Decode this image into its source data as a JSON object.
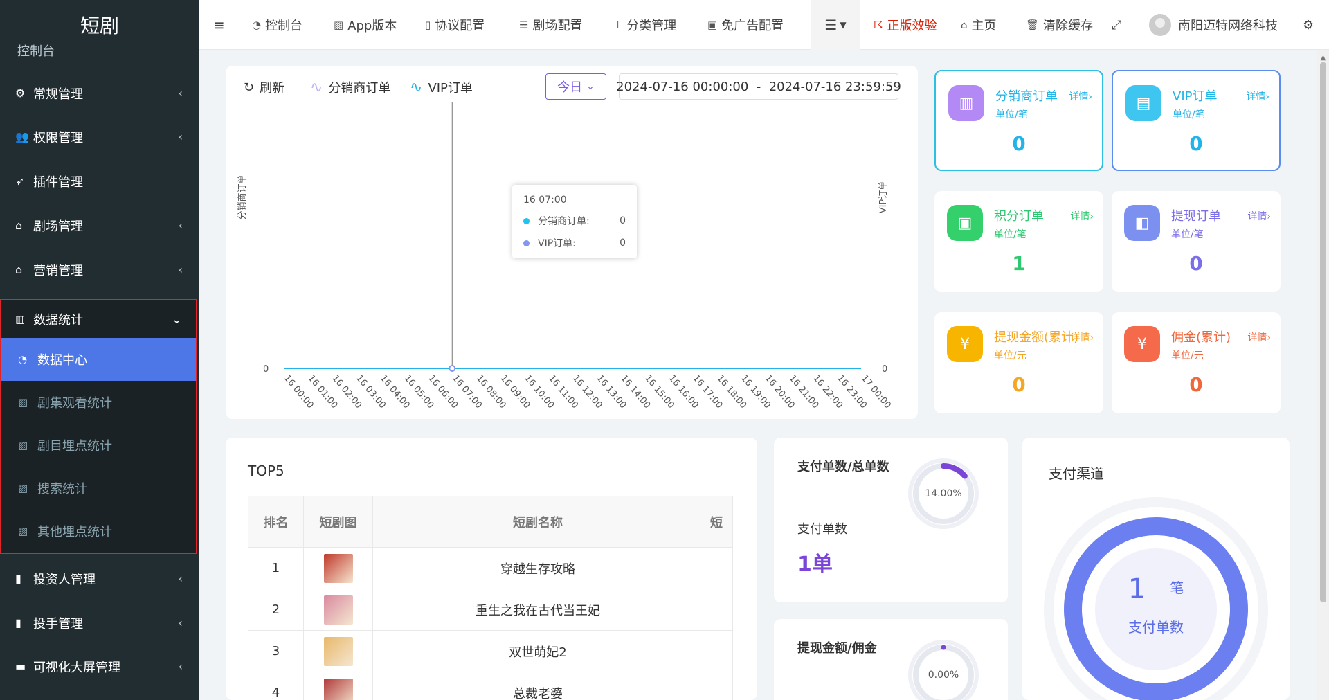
{
  "brand": "短剧",
  "sidebar": {
    "partial_item": "控制台",
    "items": [
      {
        "label": "常规管理",
        "icon": "gears-icon"
      },
      {
        "label": "权限管理",
        "icon": "users-icon"
      },
      {
        "label": "插件管理",
        "icon": "rocket-icon"
      },
      {
        "label": "剧场管理",
        "icon": "home-icon"
      },
      {
        "label": "营销管理",
        "icon": "home-icon"
      }
    ],
    "stats_group": {
      "label": "数据统计",
      "icon": "bar-chart-icon",
      "children": [
        {
          "label": "数据中心",
          "icon": "dashboard-icon",
          "active": true
        },
        {
          "label": "剧集观看统计",
          "icon": "image-icon"
        },
        {
          "label": "剧目埋点统计",
          "icon": "image-icon"
        },
        {
          "label": "搜索统计",
          "icon": "image-icon"
        },
        {
          "label": "其他埋点统计",
          "icon": "image-icon"
        }
      ]
    },
    "bottom_items": [
      {
        "label": "投资人管理",
        "icon": "id-card-icon"
      },
      {
        "label": "投手管理",
        "icon": "id-card-icon"
      },
      {
        "label": "可视化大屏管理",
        "icon": "credit-card-icon"
      }
    ]
  },
  "topbar": {
    "nav": [
      {
        "label": "控制台",
        "icon": "dashboard-icon"
      },
      {
        "label": "App版本",
        "icon": "image-icon"
      },
      {
        "label": "协议配置",
        "icon": "file-icon"
      },
      {
        "label": "剧场配置",
        "icon": "sliders-icon"
      },
      {
        "label": "分类管理",
        "icon": "sitemap-icon"
      },
      {
        "label": "免广告配置",
        "icon": "vimeo-icon"
      }
    ],
    "right": {
      "rss_label": "正版效验",
      "home_label": "主页",
      "clear_label": "清除缓存",
      "user": "南阳迈特网络科技"
    }
  },
  "chart": {
    "refresh_label": "刷新",
    "today_label": "今日",
    "date_range": "2024-07-16 00:00:00  -  2024-07-16 23:59:59",
    "tooltip": {
      "time": "16 07:00",
      "rows": [
        {
          "label": "分销商订单:",
          "value": "0",
          "color": "#22c3f1"
        },
        {
          "label": "VIP订单:",
          "value": "0",
          "color": "#8396f0"
        }
      ]
    }
  },
  "chart_data": {
    "type": "line",
    "x": [
      "16 00:00",
      "16 01:00",
      "16 02:00",
      "16 03:00",
      "16 04:00",
      "16 05:00",
      "16 06:00",
      "16 07:00",
      "16 08:00",
      "16 09:00",
      "16 10:00",
      "16 11:00",
      "16 12:00",
      "16 13:00",
      "16 14:00",
      "16 15:00",
      "16 16:00",
      "16 17:00",
      "16 18:00",
      "16 19:00",
      "16 20:00",
      "16 21:00",
      "16 22:00",
      "16 23:00",
      "17 00:00"
    ],
    "series": [
      {
        "name": "分销商订单",
        "color": "#c4b5f5",
        "values": [
          0,
          0,
          0,
          0,
          0,
          0,
          0,
          0,
          0,
          0,
          0,
          0,
          0,
          0,
          0,
          0,
          0,
          0,
          0,
          0,
          0,
          0,
          0,
          0,
          0
        ]
      },
      {
        "name": "VIP订单",
        "color": "#22b4e8",
        "values": [
          0,
          0,
          0,
          0,
          0,
          0,
          0,
          0,
          0,
          0,
          0,
          0,
          0,
          0,
          0,
          0,
          0,
          0,
          0,
          0,
          0,
          0,
          0,
          0,
          0
        ]
      }
    ],
    "ylabel_left": "分销商订单",
    "ylabel_right": "VIP订单",
    "y_ticks_left": [
      "0"
    ],
    "y_ticks_right": [
      "0"
    ],
    "highlight_x": "16 07:00"
  },
  "stat_cards": [
    {
      "title": "分销商订单",
      "unit": "单位/笔",
      "value": "0",
      "detail": "详情›",
      "color": "#22b4e8",
      "icon_bg": "#b38af5",
      "icon": "bar-chart-icon"
    },
    {
      "title": "VIP订单",
      "unit": "单位/笔",
      "value": "0",
      "detail": "详情›",
      "color": "#22b4e8",
      "icon_bg": "#3fc6f0",
      "icon": "document-icon"
    },
    {
      "title": "积分订单",
      "unit": "单位/笔",
      "value": "1",
      "detail": "详情›",
      "color": "#2ec870",
      "icon_bg": "#34d06c",
      "icon": "wallet-icon"
    },
    {
      "title": "提现订单",
      "unit": "单位/笔",
      "value": "0",
      "detail": "详情›",
      "color": "#7b6ee8",
      "icon_bg": "#7c90f0",
      "icon": "purse-icon"
    },
    {
      "title": "提现金额(累计)",
      "unit": "单位/元",
      "value": "0",
      "detail": "详情›",
      "color": "#f5a623",
      "icon_bg": "#f7b500",
      "icon": "shield-yen-icon"
    },
    {
      "title": "佣金(累计)",
      "unit": "单位/元",
      "value": "0",
      "detail": "详情›",
      "color": "#f0673c",
      "icon_bg": "#f46a4a",
      "icon": "yen-circle-icon"
    }
  ],
  "top5": {
    "title": "TOP5",
    "headers": [
      "排名",
      "短剧图",
      "短剧名称",
      "短"
    ],
    "rows": [
      {
        "rank": "1",
        "name": "穿越生存攻略",
        "thumb": "#c0392b"
      },
      {
        "rank": "2",
        "name": "重生之我在古代当王妃",
        "thumb": "#d98aa0"
      },
      {
        "rank": "3",
        "name": "双世萌妃2",
        "thumb": "#e8b86a"
      },
      {
        "rank": "4",
        "name": "总裁老婆",
        "thumb": "#b03a3a"
      }
    ]
  },
  "pay_ratio": {
    "title": "支付单数/总单数",
    "percent": "14.00%",
    "fraction": 0.14,
    "sub": "支付单数",
    "big": "1单"
  },
  "withdraw_ratio": {
    "title": "提现金额/佣金",
    "percent": "0.00%",
    "fraction": 0.0
  },
  "channel": {
    "title": "支付渠道",
    "value": "1",
    "unit": "笔",
    "label": "支付单数"
  }
}
